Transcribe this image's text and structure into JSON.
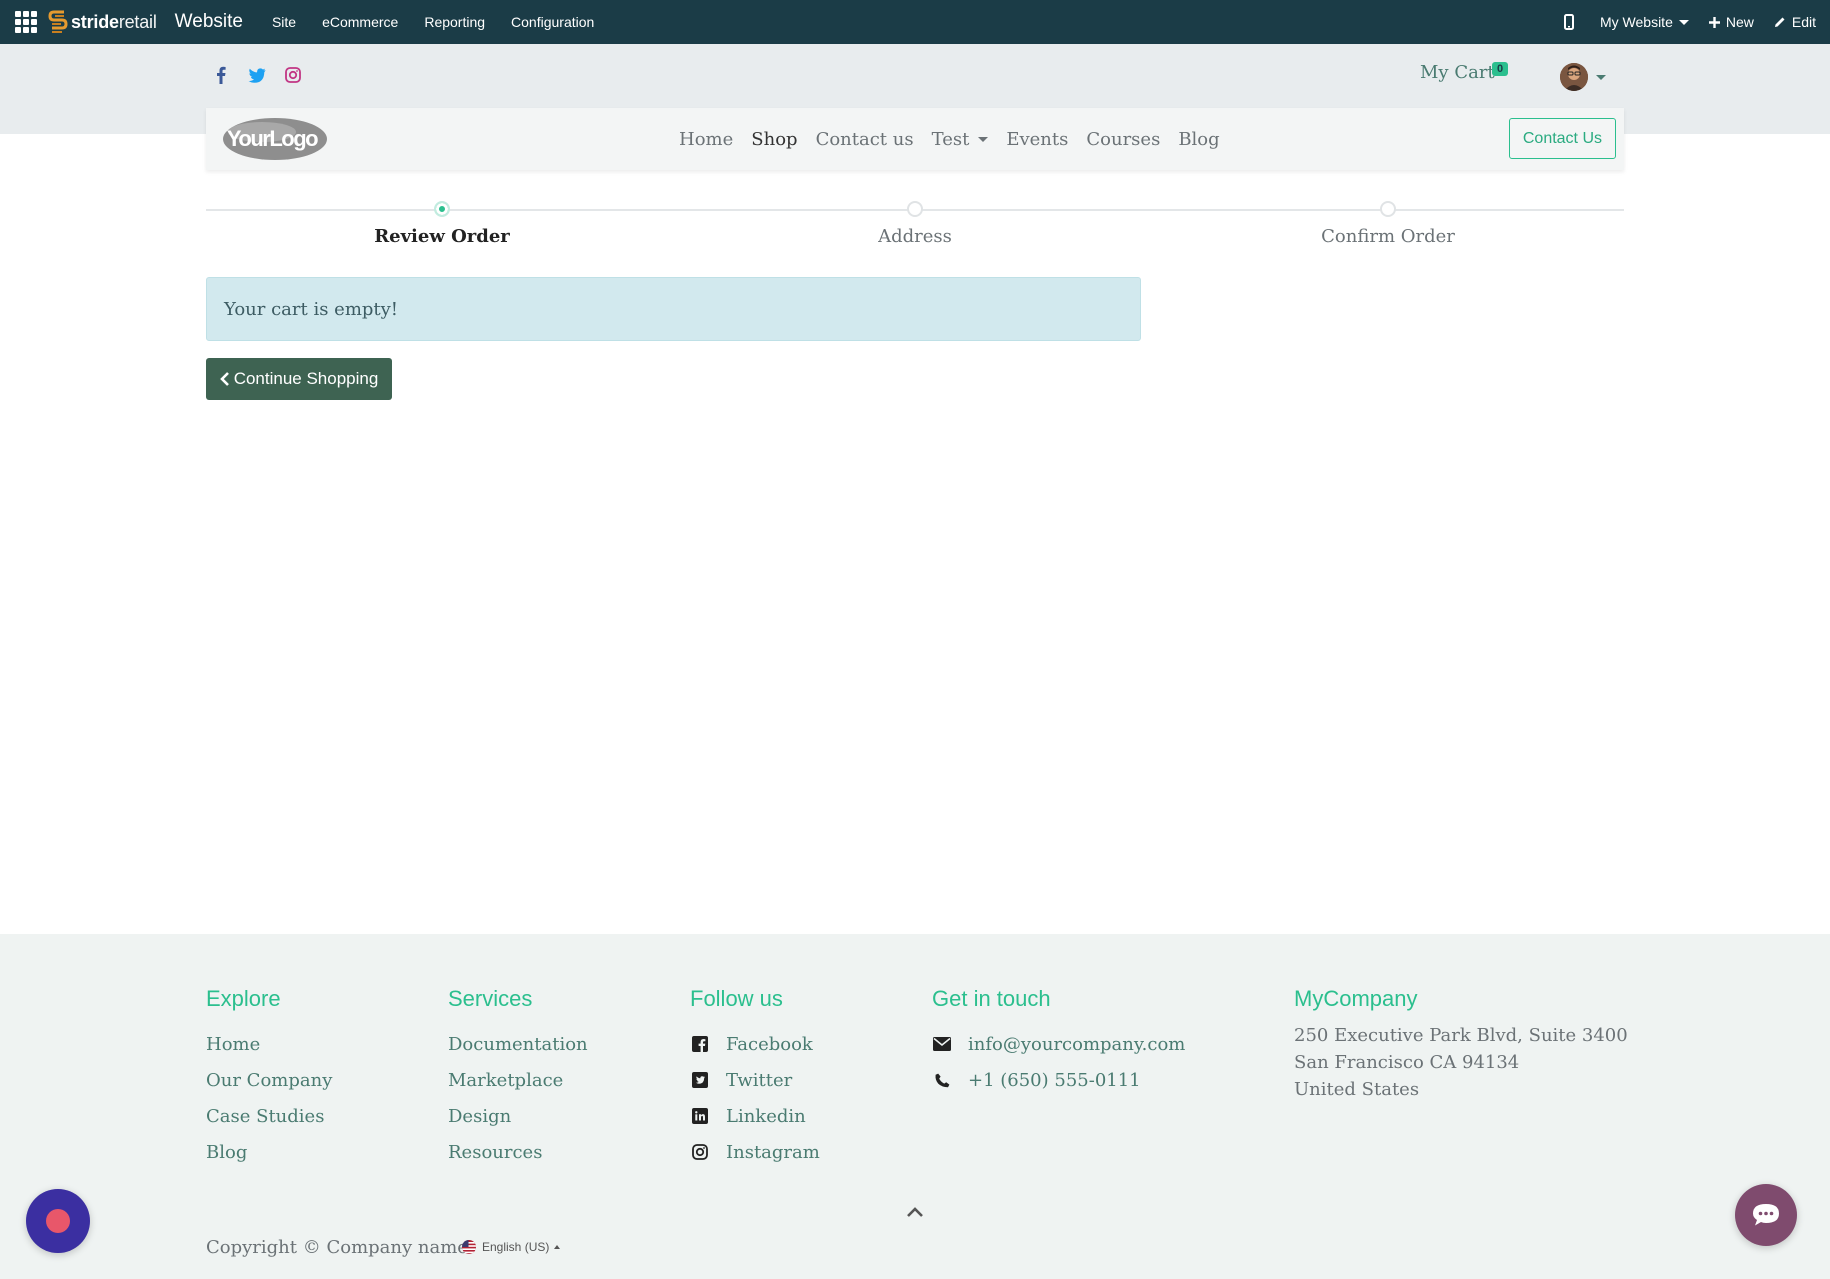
{
  "topbar": {
    "brand_bold": "stride",
    "brand_light": "retail",
    "app_name": "Website",
    "menu": [
      "Site",
      "eCommerce",
      "Reporting",
      "Configuration"
    ],
    "website_selector": "My Website",
    "new_label": "New",
    "edit_label": "Edit"
  },
  "header": {
    "social_icons": [
      "facebook-icon",
      "twitter-icon",
      "instagram-icon"
    ],
    "cart_label": "My Cart",
    "cart_count": "0",
    "nav": {
      "logo_text": "YourLogo",
      "links": [
        "Home",
        "Shop",
        "Contact us",
        "Test",
        "Events",
        "Courses",
        "Blog"
      ],
      "active_link": "Shop",
      "contact_button": "Contact Us"
    }
  },
  "wizard": {
    "steps": [
      {
        "label": "Review Order",
        "active": true
      },
      {
        "label": "Address",
        "active": false
      },
      {
        "label": "Confirm Order",
        "active": false
      }
    ]
  },
  "main": {
    "empty_message": "Your cart is empty!",
    "continue_button": "Continue Shopping"
  },
  "footer": {
    "explore": {
      "title": "Explore",
      "links": [
        "Home",
        "Our Company",
        "Case Studies",
        "Blog"
      ]
    },
    "services": {
      "title": "Services",
      "links": [
        "Documentation",
        "Marketplace",
        "Design",
        "Resources"
      ]
    },
    "follow": {
      "title": "Follow us",
      "links": [
        "Facebook",
        "Twitter",
        "Linkedin",
        "Instagram"
      ]
    },
    "contact": {
      "title": "Get in touch",
      "email": "info@yourcompany.com",
      "phone": "+1 (650) 555-0111"
    },
    "company": {
      "title": "MyCompany",
      "address_line1": "250 Executive Park Blvd, Suite 3400",
      "address_line2": "San Francisco CA 94134",
      "address_line3": "United States"
    },
    "copyright": "Copyright © Company name",
    "language": "English (US)"
  },
  "colors": {
    "topbar": "#1b3c47",
    "accent": "#2bbf8e",
    "button": "#3e6352",
    "chat": "#7f4b6e"
  }
}
